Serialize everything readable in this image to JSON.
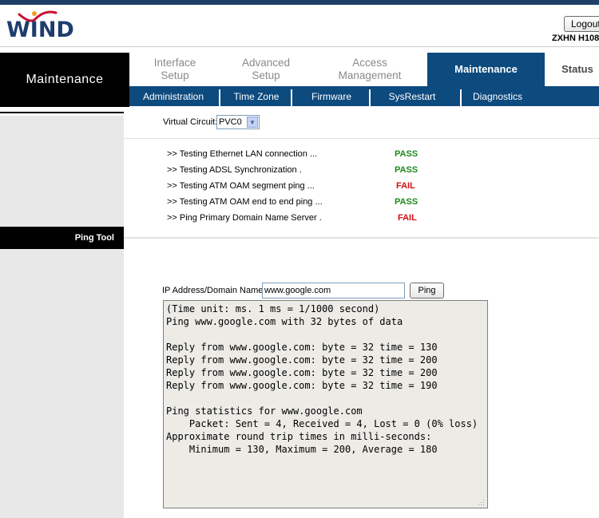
{
  "brand": {
    "logo_text": "WIND",
    "model": "ZXHN H108",
    "logout_label": "Logout",
    "colors": {
      "navy": "#0d4a7e",
      "logo_red": "#c8102e",
      "pass": "#1f8a1f",
      "fail": "#d01010"
    }
  },
  "section_title": "Maintenance",
  "main_tabs": [
    {
      "label": "Interface Setup"
    },
    {
      "label": "Advanced Setup"
    },
    {
      "label": "Access Management"
    },
    {
      "label": "Maintenance",
      "active": true
    },
    {
      "label": "Status"
    }
  ],
  "sub_tabs": [
    {
      "label": "Administration"
    },
    {
      "label": "Time Zone"
    },
    {
      "label": "Firmware"
    },
    {
      "label": "SysRestart"
    },
    {
      "label": "Diagnostics"
    }
  ],
  "sidebar": {
    "ping_label": "Ping Tool"
  },
  "diagnostics": {
    "vc_label": "Virtual Circuit:",
    "vc_value": "PVC0",
    "tests": [
      {
        "label": ">> Testing Ethernet LAN connection ...",
        "result": "PASS"
      },
      {
        "label": ">> Testing ADSL Synchronization .",
        "result": "PASS"
      },
      {
        "label": ">> Testing ATM OAM segment ping ...",
        "result": "FAIL"
      },
      {
        "label": ">> Testing ATM OAM end to end ping ...",
        "result": "PASS"
      },
      {
        "label": ">> Ping Primary Domain Name Server .",
        "result": "FAIL"
      }
    ]
  },
  "ping_tool": {
    "ip_label": "IP Address/Domain Name:",
    "ip_value": "www.google.com",
    "ping_button": "Ping",
    "output": "(Time unit: ms. 1 ms = 1/1000 second)\nPing www.google.com with 32 bytes of data\n\nReply from www.google.com: byte = 32 time = 130\nReply from www.google.com: byte = 32 time = 200\nReply from www.google.com: byte = 32 time = 200\nReply from www.google.com: byte = 32 time = 190\n\nPing statistics for www.google.com\n    Packet: Sent = 4, Received = 4, Lost = 0 (0% loss)\nApproximate round trip times in milli-seconds:\n    Minimum = 130, Maximum = 200, Average = 180"
  }
}
